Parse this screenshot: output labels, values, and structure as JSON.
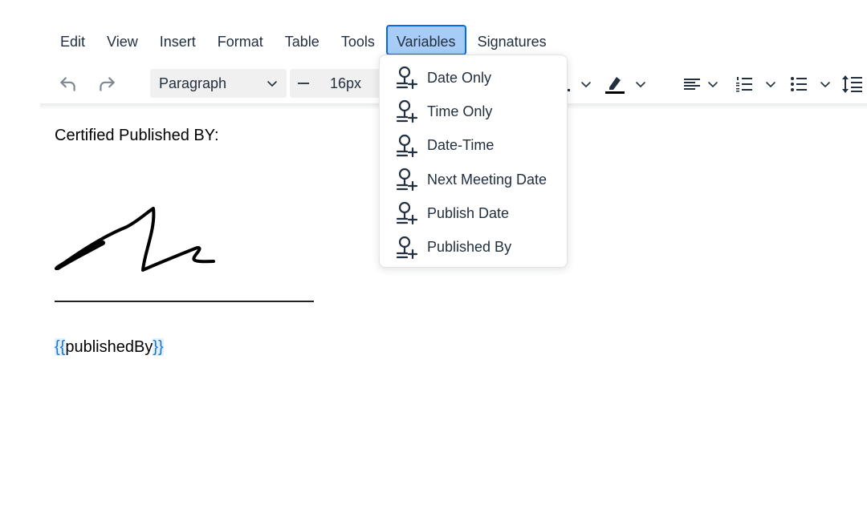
{
  "menubar": {
    "items": [
      "Edit",
      "View",
      "Insert",
      "Format",
      "Table",
      "Tools",
      "Variables",
      "Signatures"
    ],
    "active": "Variables"
  },
  "toolbar": {
    "block_format": "Paragraph",
    "font_size": "16px"
  },
  "variables_menu": {
    "items": [
      {
        "label": "Date Only",
        "icon": "insert-variable-icon"
      },
      {
        "label": "Time Only",
        "icon": "insert-variable-icon"
      },
      {
        "label": "Date-Time",
        "icon": "insert-variable-icon"
      },
      {
        "label": "Next Meeting Date",
        "icon": "insert-variable-icon"
      },
      {
        "label": "Publish Date",
        "icon": "insert-variable-icon"
      },
      {
        "label": "Published By",
        "icon": "insert-variable-icon"
      }
    ]
  },
  "document": {
    "heading": "Certified Published BY:",
    "variable_open": "{{",
    "variable_name": "publishedBy",
    "variable_close": "}}"
  },
  "colors": {
    "menu_active_bg": "#a6ccf7",
    "menu_active_border": "#006ce7",
    "variable_brace": "#1976d2",
    "text": "#222f3e"
  }
}
